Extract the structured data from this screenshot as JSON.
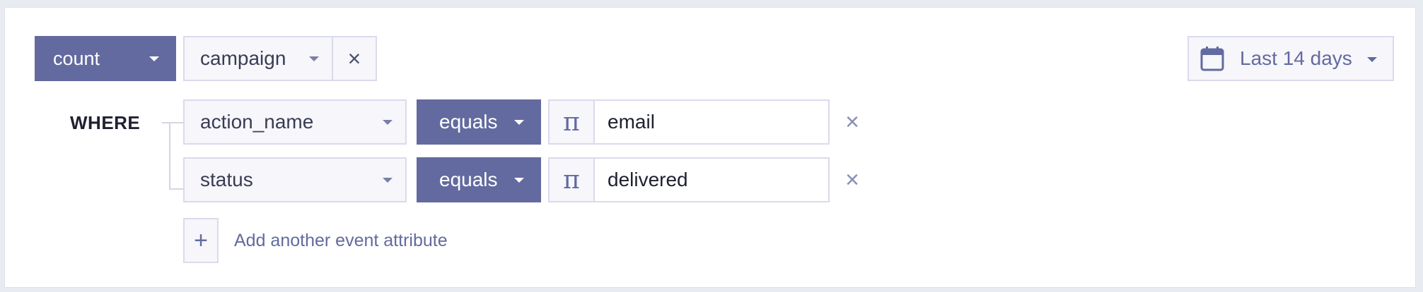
{
  "query": {
    "aggregation_label": "count",
    "property_label": "campaign",
    "date_range_label": "Last 14 days"
  },
  "where": {
    "label": "WHERE",
    "filters": [
      {
        "attribute": "action_name",
        "operator": "equals",
        "type_icon": "π",
        "value": "email"
      },
      {
        "attribute": "status",
        "operator": "equals",
        "type_icon": "π",
        "value": "delivered"
      }
    ],
    "add_label": "Add another event attribute"
  },
  "icons": {
    "remove": "×",
    "add": "+",
    "calendar": "calendar-icon",
    "dropdown": "caret-down-icon",
    "type": "pi-icon"
  },
  "colors": {
    "accent": "#636a9f",
    "light_bg": "#f6f6fb",
    "border": "#d9dbec",
    "text": "#1f2030",
    "muted_icon": "#8a8fb3"
  }
}
